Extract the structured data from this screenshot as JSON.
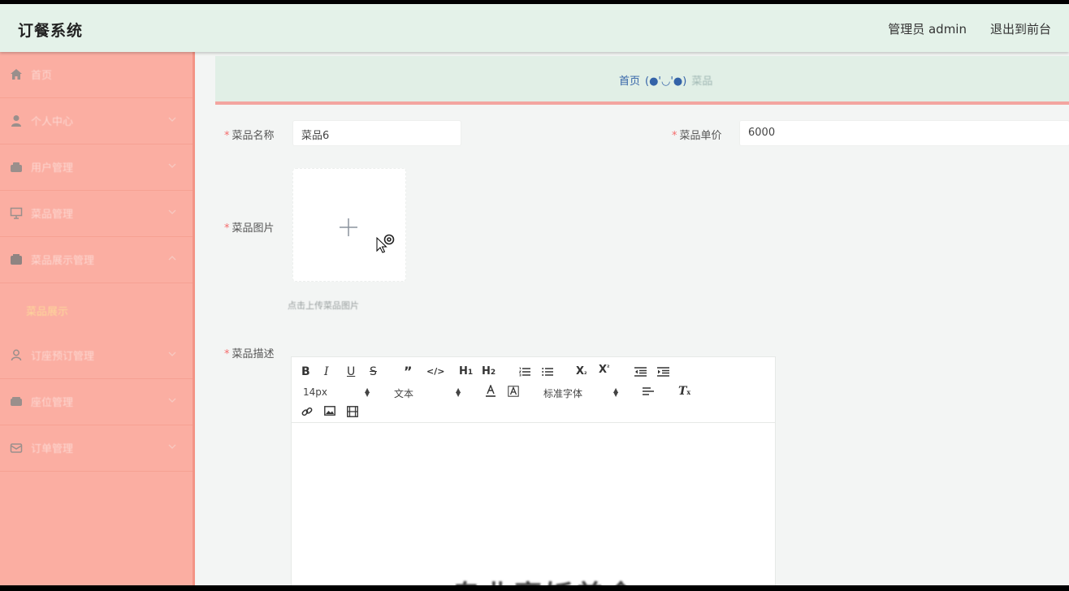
{
  "header": {
    "title": "订餐系统",
    "admin_text": "管理员 admin",
    "logout_label": "退出到前台"
  },
  "sidebar": {
    "items": [
      {
        "label": "首页",
        "icon": "home-icon",
        "chevron": false
      },
      {
        "label": "个人中心",
        "icon": "user-icon",
        "chevron": true
      },
      {
        "label": "用户管理",
        "icon": "users-icon",
        "chevron": true
      },
      {
        "label": "菜品管理",
        "icon": "monitor-icon",
        "chevron": true
      },
      {
        "label": "菜品展示管理",
        "icon": "box-icon",
        "chevron": true,
        "expanded": true
      },
      {
        "label": "订座预订管理",
        "icon": "person-icon",
        "chevron": true
      },
      {
        "label": "座位管理",
        "icon": "seat-icon",
        "chevron": true
      },
      {
        "label": "订单管理",
        "icon": "mail-icon",
        "chevron": true
      }
    ],
    "submenu_label": "菜品展示"
  },
  "breadcrumb": {
    "home": "首页",
    "separator": "(●'◡'●)",
    "current": "菜品"
  },
  "form": {
    "name_label": "菜品名称",
    "name_value": "菜品6",
    "price_label": "菜品单价",
    "price_value": "6000",
    "image_label": "菜品图片",
    "upload_tip": "点击上传菜品图片",
    "desc_label": "菜品描述"
  },
  "editor": {
    "font_size": "14px",
    "header_select": "文本",
    "font_family": "标准字体",
    "content_preview": "专业烹饪美食"
  },
  "colors": {
    "header_bg": "#e4f2e9",
    "sidebar_bg": "#fbaea2",
    "breadcrumb_link": "#3463a8",
    "required_star": "#f56c6c"
  }
}
